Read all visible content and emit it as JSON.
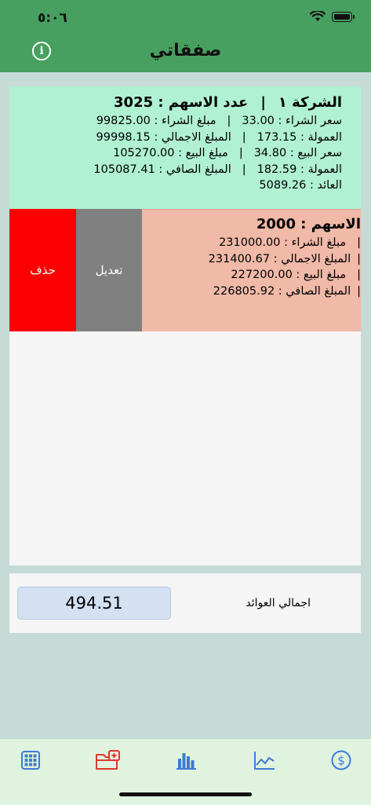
{
  "status_bar": {
    "time": "٥:٠٦"
  },
  "header": {
    "title": "صفقاتي"
  },
  "transactions": [
    {
      "company": "الشركة ١",
      "shares_label": "عدد الاسهم : 3025",
      "lines": [
        {
          "a": "سعر الشراء : 33.00",
          "b": "مبلغ الشراء : 99825.00"
        },
        {
          "a": "العمولة : 173.15",
          "b": "المبلغ الاجمالي : 99998.15"
        },
        {
          "a": "سعر البيع : 34.80",
          "b": "مبلغ البيع : 105270.00"
        },
        {
          "a": "العمولة : 182.59",
          "b": "المبلغ الصافي : 105087.41"
        },
        {
          "a": "العائد : 5089.26",
          "b": ""
        }
      ]
    },
    {
      "shares_label": "الاسهم : 2000",
      "lines": [
        {
          "b": "مبلغ الشراء : 231000.00"
        },
        {
          "b": "المبلغ الاجمالي : 231400.67"
        },
        {
          "b": "مبلغ البيع : 227200.00"
        },
        {
          "b": "المبلغ الصافي : 226805.92"
        }
      ],
      "actions": {
        "edit": "تعديل",
        "delete": "حذف"
      }
    }
  ],
  "totals": {
    "label": "اجمالي العوائد",
    "value": "494.51"
  },
  "tab_bar": {
    "items": [
      {
        "icon": "grid-icon",
        "color": "#3d7bd8"
      },
      {
        "icon": "folder-add-icon",
        "color": "#e2372b",
        "selected": true
      },
      {
        "icon": "bar-chart-icon",
        "color": "#3d7bd8"
      },
      {
        "icon": "line-chart-icon",
        "color": "#3d7bd8"
      },
      {
        "icon": "dollar-icon",
        "color": "#3d7bd8"
      }
    ]
  }
}
